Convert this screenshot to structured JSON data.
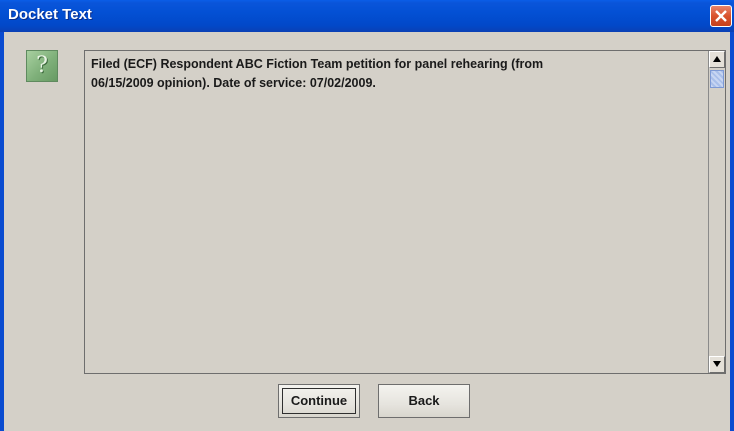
{
  "window": {
    "title": "Docket Text"
  },
  "message": {
    "line1": "Filed (ECF) Respondent ABC Fiction Team petition for panel rehearing (from",
    "line2": "06/15/2009 opinion). Date of service: 07/02/2009."
  },
  "buttons": {
    "continue_label": "Continue",
    "back_label": "Back"
  },
  "icons": {
    "dialog": "question-icon",
    "close": "close-icon",
    "scroll_up": "arrow-up-icon",
    "scroll_down": "arrow-down-icon"
  },
  "colors": {
    "titlebar": "#0350d4",
    "close_button": "#d9532e",
    "dialog_background": "#d4d0c8",
    "icon_background": "#7fb07a"
  }
}
